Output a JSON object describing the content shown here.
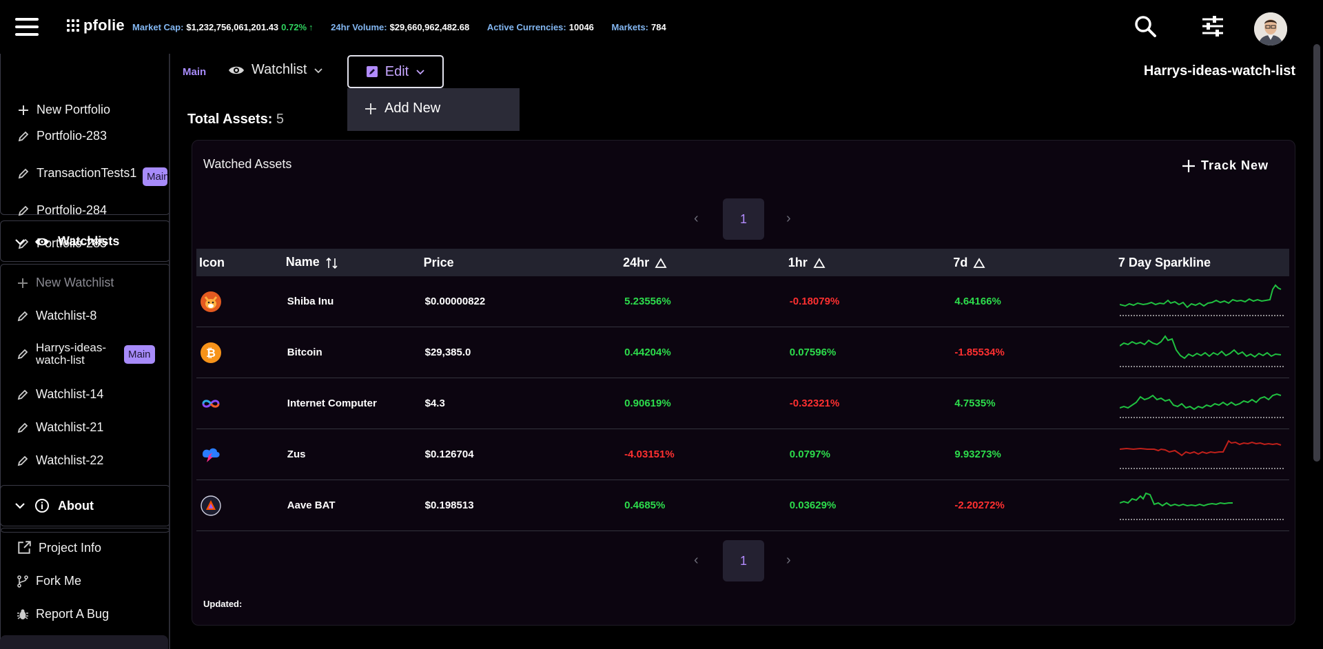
{
  "header": {
    "logo": "pfolie",
    "stats": [
      {
        "label": "Market Cap:",
        "value": "$1,232,756,061,201.43",
        "pct": "0.72%",
        "arrow": "↑"
      },
      {
        "label": "24hr Volume:",
        "value": "$29,660,962,482.68"
      },
      {
        "label": "Active Currencies:",
        "value": "10046"
      },
      {
        "label": "Markets:",
        "value": "784"
      }
    ],
    "icons": [
      "search-icon",
      "sliders-icon",
      "avatar"
    ]
  },
  "sidebar": {
    "portfolios": {
      "new_label": "New Portfolio",
      "items": [
        {
          "label": "Portfolio-283"
        },
        {
          "label": "TransactionTests1",
          "badge": "Main"
        },
        {
          "label": "Portfolio-284"
        },
        {
          "label": "Portfolio-285"
        }
      ]
    },
    "watchlists": {
      "header": "Watchlists",
      "new_label": "New Watchlist",
      "items": [
        {
          "label": "Watchlist-8"
        },
        {
          "label": "Harrys-ideas-watch-list",
          "line1": "Harrys-ideas-",
          "line2": "watch-list",
          "badge": "Main"
        },
        {
          "label": "Watchlist-14"
        },
        {
          "label": "Watchlist-21"
        },
        {
          "label": "Watchlist-22"
        }
      ]
    },
    "about": {
      "header": "About",
      "items": [
        {
          "label": "Project Info"
        },
        {
          "label": "Fork Me"
        },
        {
          "label": "Report A Bug"
        }
      ]
    }
  },
  "toolbar": {
    "main_label": "Main",
    "watchlist_label": "Watchlist",
    "edit_label": "Edit",
    "dropdown": {
      "add_new": "Add New"
    },
    "watchlist_name": "Harrys-ideas-watch-list"
  },
  "summary": {
    "total_label": "Total Assets:",
    "total_value": "5"
  },
  "card": {
    "title": "Watched Assets",
    "track_new": "Track New",
    "page": "1",
    "updated_label": "Updated:",
    "columns": [
      "Icon",
      "Name",
      "Price",
      "24hr",
      "1hr",
      "7d",
      "7 Day Sparkline"
    ],
    "rows": [
      {
        "name": "Shiba Inu",
        "price": "$0.00000822",
        "h24": "5.23556%",
        "h24_dir": "pos",
        "h1": "-0.18079%",
        "h1_dir": "neg",
        "d7": "4.64166%",
        "d7_dir": "pos",
        "icon": "shiba-inu-icon",
        "spark_color": "#20c040"
      },
      {
        "name": "Bitcoin",
        "price": "$29,385.0",
        "h24": "0.44204%",
        "h24_dir": "pos",
        "h1": "0.07596%",
        "h1_dir": "pos",
        "d7": "-1.85534%",
        "d7_dir": "neg",
        "icon": "bitcoin-icon",
        "spark_color": "#20c040"
      },
      {
        "name": "Internet Computer",
        "price": "$4.3",
        "h24": "0.90619%",
        "h24_dir": "pos",
        "h1": "-0.32321%",
        "h1_dir": "neg",
        "d7": "4.7535%",
        "d7_dir": "pos",
        "icon": "internet-computer-icon",
        "spark_color": "#20c040"
      },
      {
        "name": "Zus",
        "price": "$0.126704",
        "h24": "-4.03151%",
        "h24_dir": "neg",
        "h1": "0.0797%",
        "h1_dir": "pos",
        "d7": "9.93273%",
        "d7_dir": "pos",
        "icon": "zus-icon",
        "spark_color": "#c0201a"
      },
      {
        "name": "Aave BAT",
        "price": "$0.198513",
        "h24": "0.4685%",
        "h24_dir": "pos",
        "h1": "0.03629%",
        "h1_dir": "pos",
        "d7": "-2.20272%",
        "d7_dir": "neg",
        "icon": "aave-bat-icon",
        "spark_color": "#20c040"
      }
    ]
  },
  "colors": {
    "accent": "#a78bfa",
    "positive": "#2ddd4c",
    "negative": "#ff3030",
    "stat_label": "#83b7f2"
  }
}
